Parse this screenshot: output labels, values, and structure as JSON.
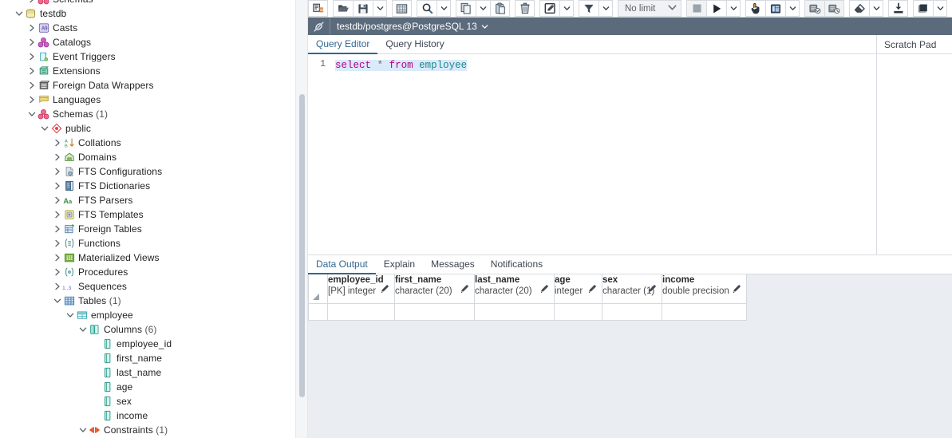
{
  "app": "pgAdmin Query Tool",
  "tree": {
    "items": [
      {
        "label": "Schemas",
        "count": "",
        "depth": 1,
        "toggle": "collapsed",
        "icon": "schemas-icon",
        "clipped": true
      },
      {
        "label": "testdb",
        "count": "",
        "depth": 0,
        "toggle": "expanded",
        "icon": "database-icon"
      },
      {
        "label": "Casts",
        "count": "",
        "depth": 1,
        "toggle": "collapsed",
        "icon": "casts-icon"
      },
      {
        "label": "Catalogs",
        "count": "",
        "depth": 1,
        "toggle": "collapsed",
        "icon": "catalogs-icon"
      },
      {
        "label": "Event Triggers",
        "count": "",
        "depth": 1,
        "toggle": "collapsed",
        "icon": "event-triggers-icon"
      },
      {
        "label": "Extensions",
        "count": "",
        "depth": 1,
        "toggle": "collapsed",
        "icon": "extensions-icon"
      },
      {
        "label": "Foreign Data Wrappers",
        "count": "",
        "depth": 1,
        "toggle": "collapsed",
        "icon": "foreign-data-wrappers-icon"
      },
      {
        "label": "Languages",
        "count": "",
        "depth": 1,
        "toggle": "collapsed",
        "icon": "languages-icon"
      },
      {
        "label": "Schemas",
        "count": "(1)",
        "depth": 1,
        "toggle": "expanded",
        "icon": "schemas-icon"
      },
      {
        "label": "public",
        "count": "",
        "depth": 2,
        "toggle": "expanded",
        "icon": "schema-icon"
      },
      {
        "label": "Collations",
        "count": "",
        "depth": 3,
        "toggle": "collapsed",
        "icon": "collations-icon"
      },
      {
        "label": "Domains",
        "count": "",
        "depth": 3,
        "toggle": "collapsed",
        "icon": "domains-icon"
      },
      {
        "label": "FTS Configurations",
        "count": "",
        "depth": 3,
        "toggle": "collapsed",
        "icon": "fts-configurations-icon"
      },
      {
        "label": "FTS Dictionaries",
        "count": "",
        "depth": 3,
        "toggle": "collapsed",
        "icon": "fts-dictionaries-icon"
      },
      {
        "label": "FTS Parsers",
        "count": "",
        "depth": 3,
        "toggle": "collapsed",
        "icon": "fts-parsers-icon"
      },
      {
        "label": "FTS Templates",
        "count": "",
        "depth": 3,
        "toggle": "collapsed",
        "icon": "fts-templates-icon"
      },
      {
        "label": "Foreign Tables",
        "count": "",
        "depth": 3,
        "toggle": "collapsed",
        "icon": "foreign-tables-icon"
      },
      {
        "label": "Functions",
        "count": "",
        "depth": 3,
        "toggle": "collapsed",
        "icon": "functions-icon"
      },
      {
        "label": "Materialized Views",
        "count": "",
        "depth": 3,
        "toggle": "collapsed",
        "icon": "materialized-views-icon"
      },
      {
        "label": "Procedures",
        "count": "",
        "depth": 3,
        "toggle": "collapsed",
        "icon": "procedures-icon"
      },
      {
        "label": "Sequences",
        "count": "",
        "depth": 3,
        "toggle": "collapsed",
        "icon": "sequences-icon"
      },
      {
        "label": "Tables",
        "count": "(1)",
        "depth": 3,
        "toggle": "expanded",
        "icon": "tables-icon"
      },
      {
        "label": "employee",
        "count": "",
        "depth": 4,
        "toggle": "expanded",
        "icon": "table-icon"
      },
      {
        "label": "Columns",
        "count": "(6)",
        "depth": 5,
        "toggle": "expanded",
        "icon": "columns-icon"
      },
      {
        "label": "employee_id",
        "count": "",
        "depth": 6,
        "toggle": "none",
        "icon": "column-icon"
      },
      {
        "label": "first_name",
        "count": "",
        "depth": 6,
        "toggle": "none",
        "icon": "column-icon"
      },
      {
        "label": "last_name",
        "count": "",
        "depth": 6,
        "toggle": "none",
        "icon": "column-icon"
      },
      {
        "label": "age",
        "count": "",
        "depth": 6,
        "toggle": "none",
        "icon": "column-icon"
      },
      {
        "label": "sex",
        "count": "",
        "depth": 6,
        "toggle": "none",
        "icon": "column-icon"
      },
      {
        "label": "income",
        "count": "",
        "depth": 6,
        "toggle": "none",
        "icon": "column-icon"
      },
      {
        "label": "Constraints",
        "count": "(1)",
        "depth": 5,
        "toggle": "expanded",
        "icon": "constraints-icon"
      }
    ]
  },
  "toolbar": {
    "groups": [
      {
        "buttons": [
          {
            "name": "open-file-manager-button",
            "icon": "file-manager-icon",
            "title": "File Manager"
          }
        ]
      },
      {
        "buttons": [
          {
            "name": "open-file-button",
            "icon": "folder-open-icon",
            "title": "Open File"
          },
          {
            "name": "save-file-button",
            "icon": "save-icon",
            "title": "Save File"
          },
          {
            "name": "save-dropdown-button",
            "icon": "chevron-down-icon",
            "caret": true,
            "title": "Save options"
          }
        ]
      },
      {
        "buttons": [
          {
            "name": "edit-grid-button",
            "icon": "grid-icon",
            "title": "Edit grid"
          }
        ]
      },
      {
        "buttons": [
          {
            "name": "find-button",
            "icon": "search-icon",
            "title": "Find"
          },
          {
            "name": "find-dropdown-button",
            "icon": "chevron-down-icon",
            "caret": true,
            "title": "Find options"
          }
        ]
      },
      {
        "buttons": [
          {
            "name": "copy-button",
            "icon": "copy-icon",
            "title": "Copy"
          },
          {
            "name": "copy-dropdown-button",
            "icon": "chevron-down-icon",
            "caret": true,
            "title": "Copy options"
          },
          {
            "name": "paste-button",
            "icon": "paste-icon",
            "title": "Paste"
          }
        ]
      },
      {
        "buttons": [
          {
            "name": "delete-row-button",
            "icon": "trash-icon",
            "title": "Delete row"
          }
        ]
      },
      {
        "buttons": [
          {
            "name": "edit-button",
            "icon": "pencil-square-icon",
            "title": "Edit"
          },
          {
            "name": "edit-dropdown-button",
            "icon": "chevron-down-icon",
            "caret": true,
            "title": "Edit options"
          }
        ]
      },
      {
        "buttons": [
          {
            "name": "filter-button",
            "icon": "funnel-icon",
            "title": "Filter"
          },
          {
            "name": "filter-dropdown-button",
            "icon": "chevron-down-icon",
            "caret": true,
            "title": "Filter options"
          }
        ]
      }
    ],
    "row_limit": {
      "name": "row-limit-select",
      "value": "No limit"
    },
    "groups2": [
      {
        "buttons": [
          {
            "name": "stop-query-button",
            "icon": "stop-icon",
            "title": "Stop",
            "disabled": true
          },
          {
            "name": "execute-query-button",
            "icon": "play-icon",
            "title": "Execute/Refresh"
          },
          {
            "name": "execute-dropdown-button",
            "icon": "chevron-down-icon",
            "caret": true,
            "title": "Execute options"
          }
        ]
      },
      {
        "buttons": [
          {
            "name": "explain-button",
            "icon": "hand-pointer-icon",
            "title": "Explain"
          },
          {
            "name": "explain-analyze-button",
            "icon": "explain-table-icon",
            "title": "Explain analyze"
          },
          {
            "name": "explain-dropdown-button",
            "icon": "chevron-down-icon",
            "caret": true,
            "title": "Explain options"
          }
        ]
      },
      {
        "buttons": [
          {
            "name": "commit-button",
            "icon": "commit-icon",
            "title": "Commit",
            "disabled": true
          },
          {
            "name": "rollback-button",
            "icon": "rollback-icon",
            "title": "Rollback",
            "disabled": true
          }
        ]
      },
      {
        "buttons": [
          {
            "name": "clear-button",
            "icon": "eraser-icon",
            "title": "Clear"
          },
          {
            "name": "clear-dropdown-button",
            "icon": "chevron-down-icon",
            "caret": true,
            "title": "Clear options"
          }
        ]
      },
      {
        "buttons": [
          {
            "name": "download-csv-button",
            "icon": "download-icon",
            "title": "Download as CSV"
          }
        ]
      },
      {
        "buttons": [
          {
            "name": "macros-button",
            "icon": "macro-icon",
            "title": "Macros"
          },
          {
            "name": "macros-dropdown-button",
            "icon": "chevron-down-icon",
            "caret": true,
            "title": "Macro options"
          }
        ]
      }
    ]
  },
  "connection": {
    "icon": "connection-icon",
    "title": "testdb/postgres@PostgreSQL 13",
    "caret": "chevron-down-icon"
  },
  "editor": {
    "tabs": [
      {
        "label": "Query Editor",
        "active": true
      },
      {
        "label": "Query History",
        "active": false
      }
    ],
    "line_number": "1",
    "sql_tokens": [
      {
        "text": "select",
        "type": "kw"
      },
      {
        "text": " ",
        "type": "op"
      },
      {
        "text": "*",
        "type": "op"
      },
      {
        "text": " ",
        "type": "op"
      },
      {
        "text": "from",
        "type": "kw"
      },
      {
        "text": " ",
        "type": "op"
      },
      {
        "text": "employee",
        "type": "ident"
      }
    ],
    "sql_text": "select * from employee"
  },
  "scratch_pad": {
    "title": "Scratch Pad",
    "value": ""
  },
  "output": {
    "tabs": [
      {
        "label": "Data Output",
        "active": true
      },
      {
        "label": "Explain",
        "active": false
      },
      {
        "label": "Messages",
        "active": false
      },
      {
        "label": "Notifications",
        "active": false
      }
    ],
    "columns": [
      {
        "name": "employee_id",
        "type": "[PK] integer",
        "width": 84
      },
      {
        "name": "first_name",
        "type": "character (20)",
        "width": 100
      },
      {
        "name": "last_name",
        "type": "character (20)",
        "width": 100
      },
      {
        "name": "age",
        "type": "integer",
        "width": 60
      },
      {
        "name": "sex",
        "type": "character (1)",
        "width": 75
      },
      {
        "name": "income",
        "type": "double precision",
        "width": 106
      }
    ],
    "rows": [],
    "empty_row_count": 1
  },
  "colors": {
    "accent": "#326690",
    "conn_bar": "#5b6b7c",
    "keyword": "#b30086",
    "identifier": "#1b8a8a",
    "selection": "#dbeafb",
    "panel_bg": "#eaedf1"
  }
}
